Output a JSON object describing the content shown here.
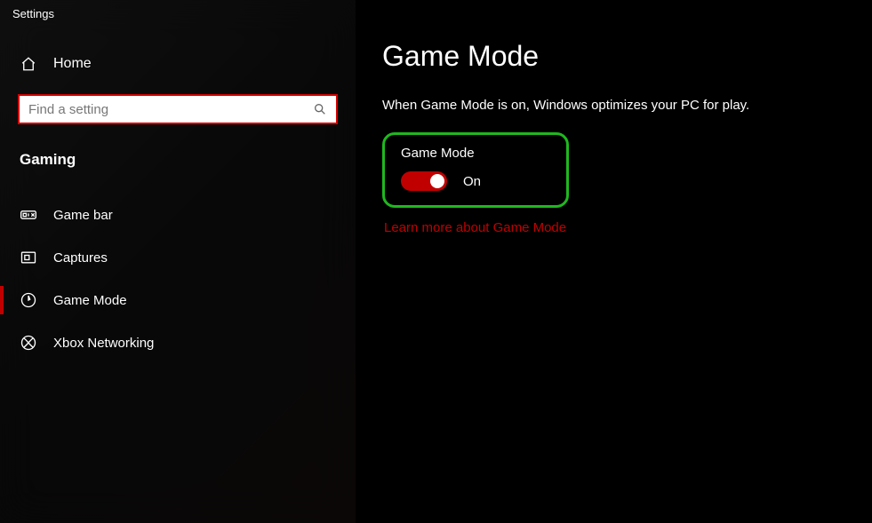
{
  "window": {
    "title": "Settings"
  },
  "sidebar": {
    "home_label": "Home",
    "search_placeholder": "Find a setting",
    "category": "Gaming",
    "items": [
      {
        "label": "Game bar",
        "icon": "gamebar-icon",
        "active": false
      },
      {
        "label": "Captures",
        "icon": "captures-icon",
        "active": false
      },
      {
        "label": "Game Mode",
        "icon": "gamemode-icon",
        "active": true
      },
      {
        "label": "Xbox Networking",
        "icon": "xbox-icon",
        "active": false
      }
    ]
  },
  "main": {
    "title": "Game Mode",
    "description": "When Game Mode is on, Windows optimizes your PC for play.",
    "toggle": {
      "label": "Game Mode",
      "state": "On",
      "on": true
    },
    "learn_link": "Learn more about Game Mode"
  },
  "colors": {
    "accent": "#c00000",
    "highlight_border": "#1fb81f"
  }
}
